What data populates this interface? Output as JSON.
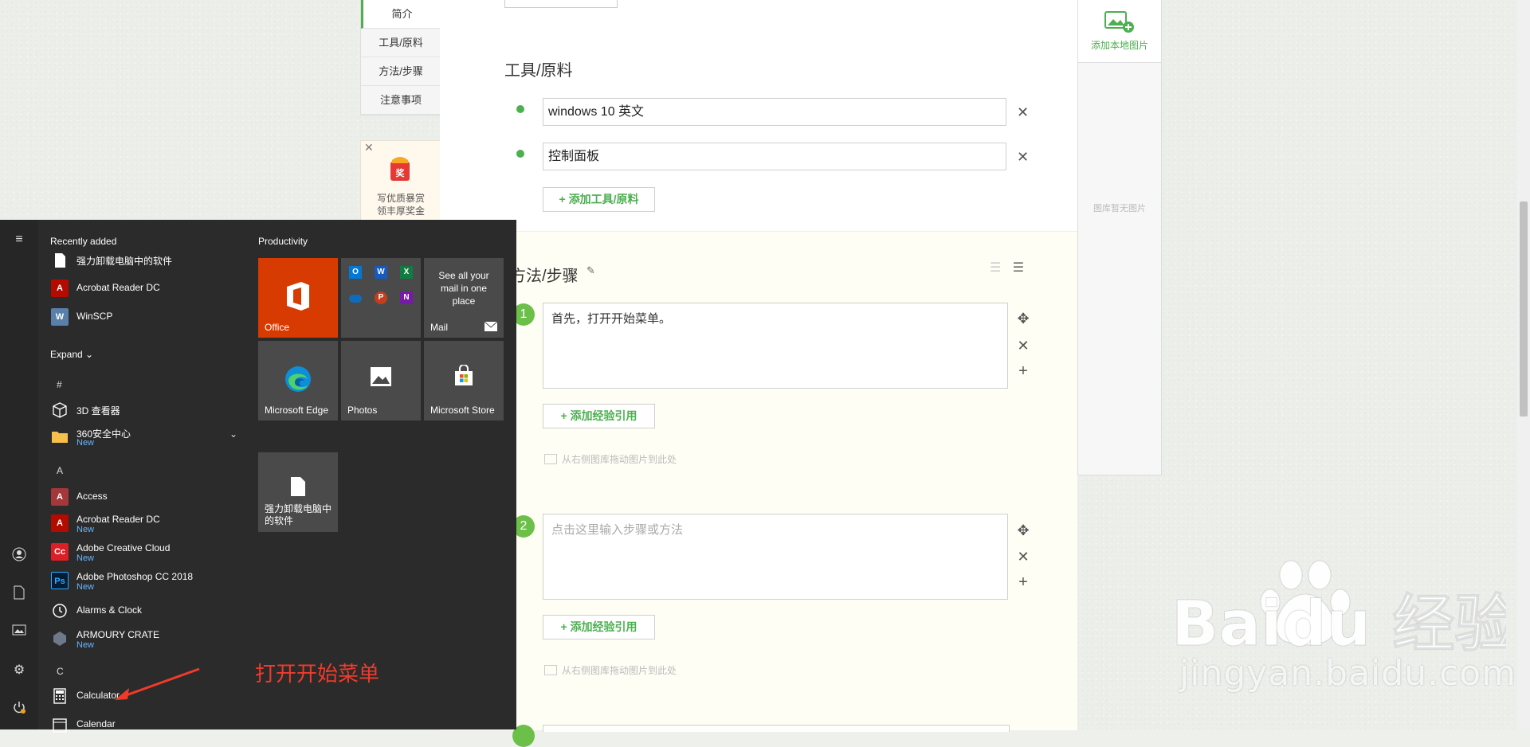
{
  "left_nav": {
    "items": [
      {
        "label": "简介",
        "active": true
      },
      {
        "label": "工具/原料",
        "active": false
      },
      {
        "label": "方法/步骤",
        "active": false
      },
      {
        "label": "注意事项",
        "active": false
      }
    ],
    "reward": {
      "badge": "奖",
      "line1": "写优质暴赏",
      "line2": "领丰厚奖金"
    }
  },
  "tools_section": {
    "title": "工具/原料",
    "items": [
      "windows 10 英文",
      "控制面板"
    ],
    "add_button": "+ 添加工具/原料"
  },
  "steps_section": {
    "title": "方法/步骤",
    "steps": [
      {
        "num": "1",
        "text": "首先，打开开始菜单。",
        "placeholder": ""
      },
      {
        "num": "2",
        "text": "",
        "placeholder": "点击这里输入步骤或方法"
      }
    ],
    "add_ref_button": "+ 添加经验引用",
    "drag_hint": "从右侧图库拖动图片到此处"
  },
  "image_panel": {
    "add_label": "添加本地图片",
    "empty_text": "图库暂无图片"
  },
  "watermark": {
    "brand": "Baidu 经验",
    "url": "jingyan.baidu.com"
  },
  "start_menu": {
    "recently_added_title": "Recently added",
    "recent": [
      {
        "name": "强力卸载电脑中的软件",
        "icon": "document-icon"
      },
      {
        "name": "Acrobat Reader DC",
        "icon": "acrobat-icon"
      },
      {
        "name": "WinSCP",
        "icon": "winscp-icon"
      }
    ],
    "expand_label": "Expand",
    "sections": [
      {
        "letter": "#",
        "apps": [
          {
            "name": "3D 查看器",
            "new": false
          },
          {
            "name": "360安全中心",
            "new": true
          }
        ]
      },
      {
        "letter": "A",
        "apps": [
          {
            "name": "Access",
            "new": false
          },
          {
            "name": "Acrobat Reader DC",
            "new": true
          },
          {
            "name": "Adobe Creative Cloud",
            "new": true
          },
          {
            "name": "Adobe Photoshop CC 2018",
            "new": true
          },
          {
            "name": "Alarms & Clock",
            "new": false
          },
          {
            "name": "ARMOURY CRATE",
            "new": true
          }
        ]
      },
      {
        "letter": "C",
        "apps": [
          {
            "name": "Calculator",
            "new": false
          },
          {
            "name": "Calendar",
            "new": false
          }
        ]
      }
    ],
    "new_label": "New",
    "group_title": "Productivity",
    "tiles": {
      "office": "Office",
      "mail_text": "See all your mail in one place",
      "mail_label": "Mail",
      "edge": "Microsoft Edge",
      "photos": "Photos",
      "store": "Microsoft Store",
      "doc": "强力卸载电脑中的软件"
    },
    "office_apps": [
      "O",
      "W",
      "X",
      "",
      "P",
      "N"
    ]
  },
  "annotation": {
    "text": "打开开始菜单"
  },
  "colors": {
    "accent_green": "#4caf50",
    "start_bg": "#2b2b2b",
    "office_red": "#d83b01",
    "note_red": "#f03b2b"
  }
}
